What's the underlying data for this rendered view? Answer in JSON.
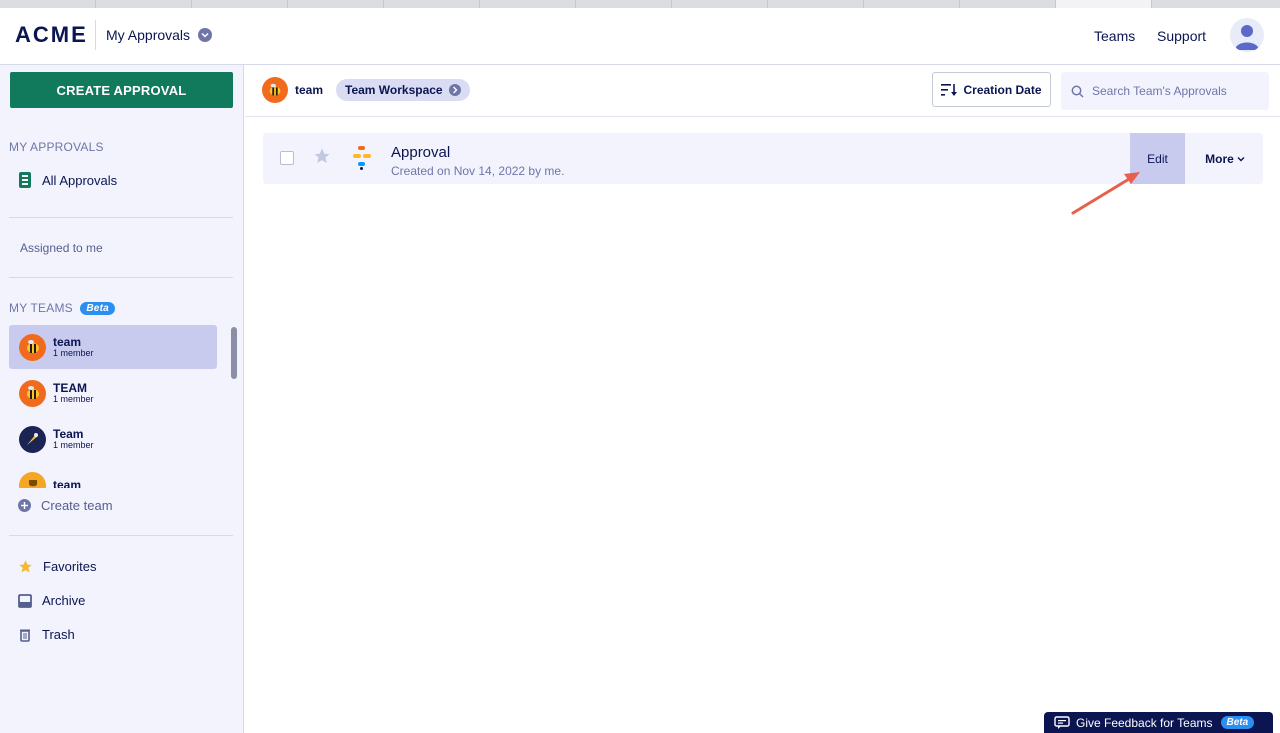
{
  "header": {
    "logo": "ACME",
    "app_title": "My Approvals",
    "links": [
      "Teams",
      "Support"
    ]
  },
  "sidebar": {
    "create_label": "CREATE APPROVAL",
    "my_approvals_title": "MY APPROVALS",
    "all_approvals": "All Approvals",
    "assigned": "Assigned to me",
    "my_teams_title": "MY TEAMS",
    "beta": "Beta",
    "teams": [
      {
        "name": "team",
        "members": "1 member",
        "selected": true
      },
      {
        "name": "TEAM",
        "members": "1 member",
        "selected": false
      },
      {
        "name": "Team",
        "members": "1 member",
        "selected": false
      },
      {
        "name": "team",
        "members": "",
        "selected": false
      }
    ],
    "create_team": "Create team",
    "bottom": [
      {
        "label": "Favorites",
        "icon": "star-icon"
      },
      {
        "label": "Archive",
        "icon": "archive-icon"
      },
      {
        "label": "Trash",
        "icon": "trash-icon"
      }
    ]
  },
  "toolbar": {
    "team": "team",
    "workspace": "Team Workspace",
    "sort_label": "Creation Date",
    "search_placeholder": "Search Team's Approvals"
  },
  "approvals": [
    {
      "title": "Approval",
      "subtitle": "Created on Nov 14, 2022 by me.",
      "edit": "Edit",
      "more": "More"
    }
  ],
  "feedback": {
    "label": "Give Feedback for Teams",
    "beta": "Beta"
  },
  "colors": {
    "navy": "#0a1551",
    "green": "#117a5d",
    "lavender": "#f3f3fe",
    "selected": "#c8cbee",
    "accent_blue": "#2b8ef0",
    "arrow": "#e8604c"
  }
}
